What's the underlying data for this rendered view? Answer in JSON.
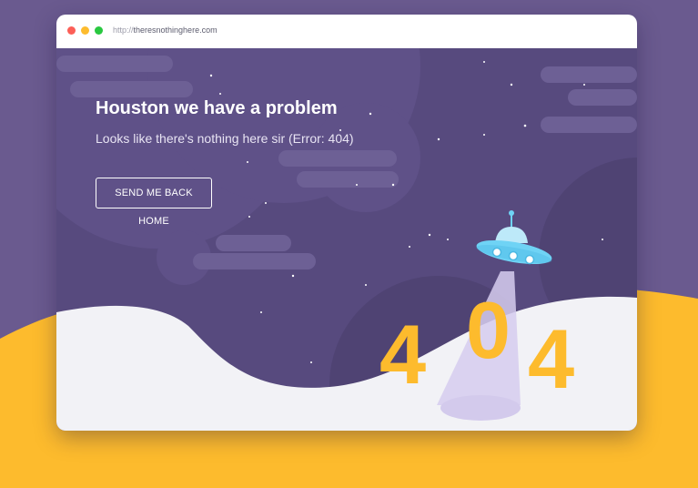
{
  "browser": {
    "url_protocol": "http://",
    "url_host": "theresnothinghere.com"
  },
  "page": {
    "headline": "Houston we have a problem",
    "message": "Looks like there's nothing here sir (Error: 404)",
    "home_button_label": "SEND ME BACK HOME",
    "error_digits": [
      "4",
      "0",
      "4"
    ]
  },
  "icons": {
    "window_controls": [
      "close-dot",
      "minimize-dot",
      "maximize-dot"
    ],
    "illustration": [
      "ufo-icon",
      "light-beam",
      "stars",
      "clouds"
    ]
  },
  "colors": {
    "background": "#6a5a8f",
    "sky": "#574a7e",
    "ground": "#f2f2f6",
    "accent_yellow": "#fdbb2d",
    "ufo": "#6fd3f5"
  }
}
